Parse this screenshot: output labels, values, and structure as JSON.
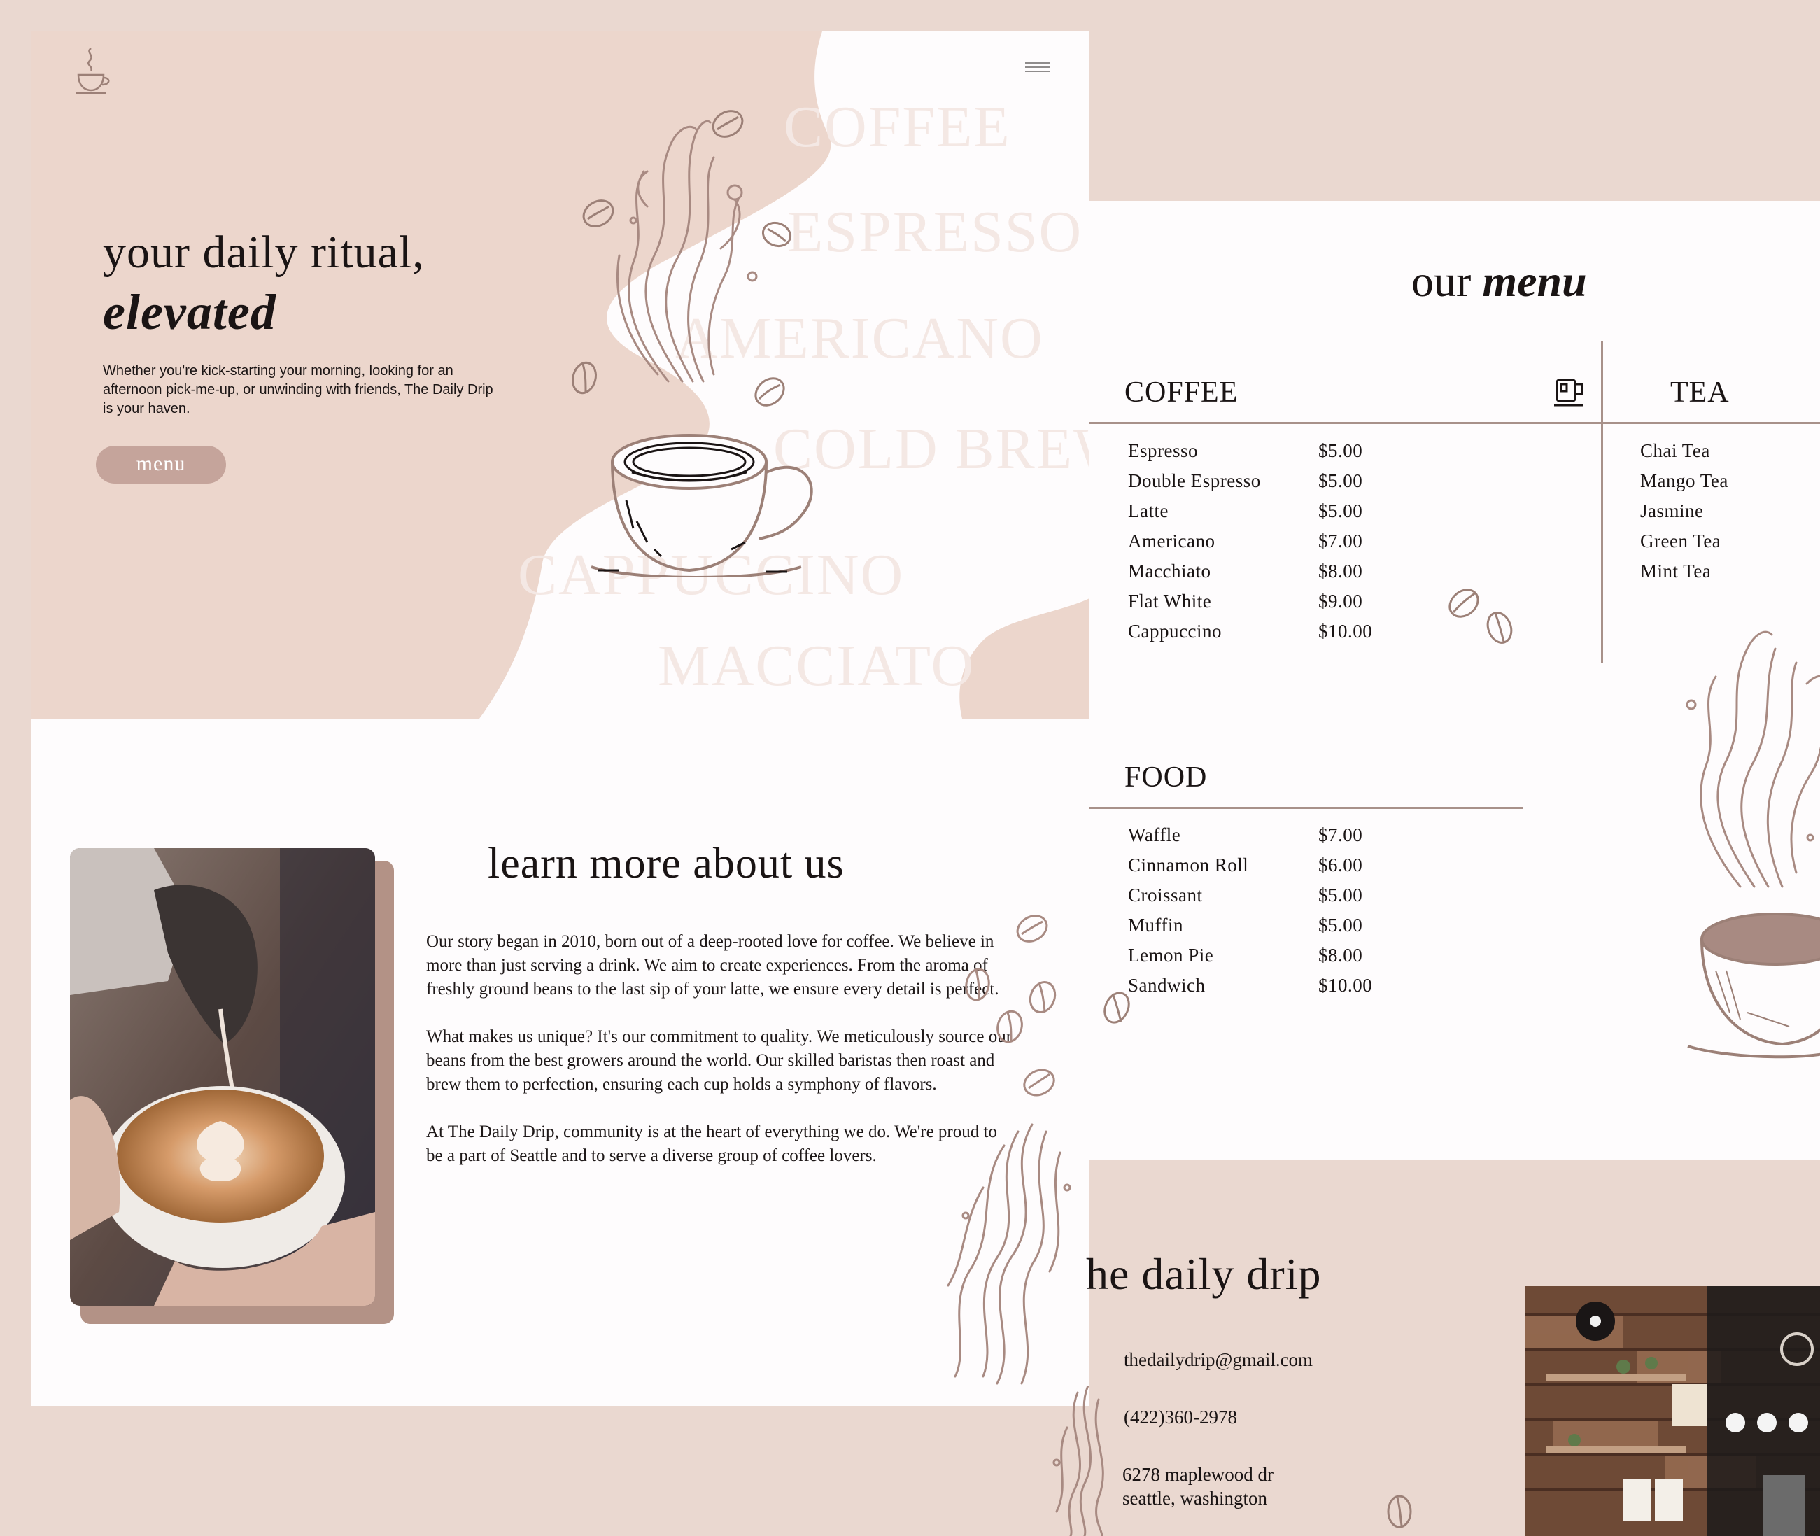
{
  "colors": {
    "page_bg": "#ead8d0",
    "hero_bg": "#ecd6cc",
    "panel_bg": "#fefcfd",
    "accent": "#c5a49b",
    "rule": "#a8918a",
    "ink": "#1a1414",
    "illustration": "#a88a82",
    "watermark": "#f4e8e4"
  },
  "hero": {
    "logo_icon": "coffee-cup-logo-icon",
    "menu_icon": "hamburger-menu-icon",
    "title_line1": "your daily ritual,",
    "title_line2": "elevated",
    "description": "Whether you're kick-starting your morning, looking for an afternoon pick-me-up, or unwinding with friends, The Daily Drip is your haven.",
    "button_label": "menu",
    "background_words": [
      "COFFEE",
      "ESPRESSO",
      "AMERICANO",
      "COLD BREW",
      "CAPPUCCINO",
      "MACCIATO"
    ]
  },
  "about": {
    "title": "learn more about us",
    "paragraphs": [
      "Our story began in 2010, born out of a deep-rooted love for coffee. We believe in more than just serving a drink. We aim to create experiences. From the aroma of freshly ground beans to the last sip of your latte, we ensure every detail is perfect.",
      "What makes us unique? It's our commitment to quality. We meticulously source our beans from the best growers around the world. Our skilled baristas then roast and brew them to perfection, ensuring each cup holds a symphony of flavors.",
      "At The Daily Drip, community is at the heart of everything we do. We're proud to be a part of Seattle and to serve a diverse group of coffee lovers."
    ]
  },
  "menu": {
    "heading_prefix": "our",
    "heading_bold": "menu",
    "coffee": {
      "title": "COFFEE",
      "icon": "coffee-mug-icon",
      "items": [
        {
          "name": "Espresso",
          "price": "$5.00"
        },
        {
          "name": "Double Espresso",
          "price": "$5.00"
        },
        {
          "name": "Latte",
          "price": "$5.00"
        },
        {
          "name": "Americano",
          "price": "$7.00"
        },
        {
          "name": "Macchiato",
          "price": "$8.00"
        },
        {
          "name": "Flat White",
          "price": "$9.00"
        },
        {
          "name": "Cappuccino",
          "price": "$10.00"
        }
      ]
    },
    "tea": {
      "title": "TEA",
      "items": [
        "Chai Tea",
        "Mango Tea",
        "Jasmine",
        "Green Tea",
        "Mint Tea"
      ]
    },
    "food": {
      "title": "FOOD",
      "items": [
        {
          "name": "Waffle",
          "price": "$7.00"
        },
        {
          "name": "Cinnamon Roll",
          "price": "$6.00"
        },
        {
          "name": "Croissant",
          "price": "$5.00"
        },
        {
          "name": "Muffin",
          "price": "$5.00"
        },
        {
          "name": "Lemon Pie",
          "price": "$8.00"
        },
        {
          "name": "Sandwich",
          "price": "$10.00"
        }
      ]
    }
  },
  "contact": {
    "title": "he daily drip",
    "email": "thedailydrip@gmail.com",
    "phone": "(422)360-2978",
    "address_line1": "6278 maplewood dr",
    "address_line2": "seattle, washington"
  }
}
